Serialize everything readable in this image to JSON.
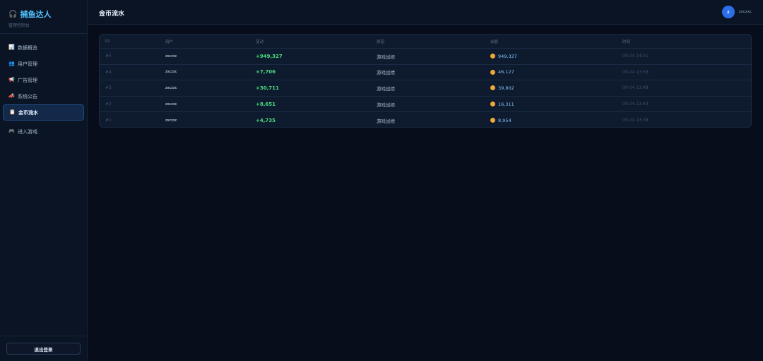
{
  "app": {
    "title": "捕鱼达人",
    "subtitle": "管理控制台",
    "icon": "headset-icon"
  },
  "sidebar": {
    "items": [
      {
        "label": "数据概览",
        "icon": "bar-chart-icon",
        "glyph": "📊",
        "active": false
      },
      {
        "label": "用户管理",
        "icon": "users-icon",
        "glyph": "👥",
        "active": false
      },
      {
        "label": "广告管理",
        "icon": "megaphone-icon",
        "glyph": "📢",
        "active": false
      },
      {
        "label": "系统公告",
        "icon": "announcement-icon",
        "glyph": "📣",
        "active": false
      },
      {
        "label": "金币流水",
        "icon": "ledger-icon",
        "glyph": "📋",
        "active": true
      },
      {
        "label": "进入游戏",
        "icon": "gamepad-icon",
        "glyph": "🎮",
        "active": false
      }
    ],
    "logout_label": "退出登录"
  },
  "header": {
    "page_title": "金币流水",
    "avatar_initial": "z",
    "username": "zxczxc"
  },
  "table": {
    "columns": {
      "id": "ID",
      "user": "用户",
      "change": "变动",
      "reason": "原因",
      "balance": "余额",
      "time": "时间"
    },
    "rows": [
      {
        "id": "#5",
        "user": "zxczxc",
        "change": "+949,327",
        "reason": "游戏战绩",
        "balance": "949,327",
        "time": "09-04 14:01"
      },
      {
        "id": "#4",
        "user": "zxczxc",
        "change": "+7,706",
        "reason": "游戏战绩",
        "balance": "46,127",
        "time": "09-04 13:56"
      },
      {
        "id": "#3",
        "user": "zxczxc",
        "change": "+30,711",
        "reason": "游戏战绩",
        "balance": "39,802",
        "time": "09-04 13:48"
      },
      {
        "id": "#2",
        "user": "zxczxc",
        "change": "+8,651",
        "reason": "游戏战绩",
        "balance": "16,311",
        "time": "09-04 13:43"
      },
      {
        "id": "#1",
        "user": "zxczxc",
        "change": "+4,735",
        "reason": "游戏战绩",
        "balance": "8,954",
        "time": "09-04 13:38"
      }
    ]
  },
  "colors": {
    "accent": "#4fc3ff",
    "positive": "#4ade80",
    "coin": "#f0a83a",
    "background": "#070d1a"
  }
}
